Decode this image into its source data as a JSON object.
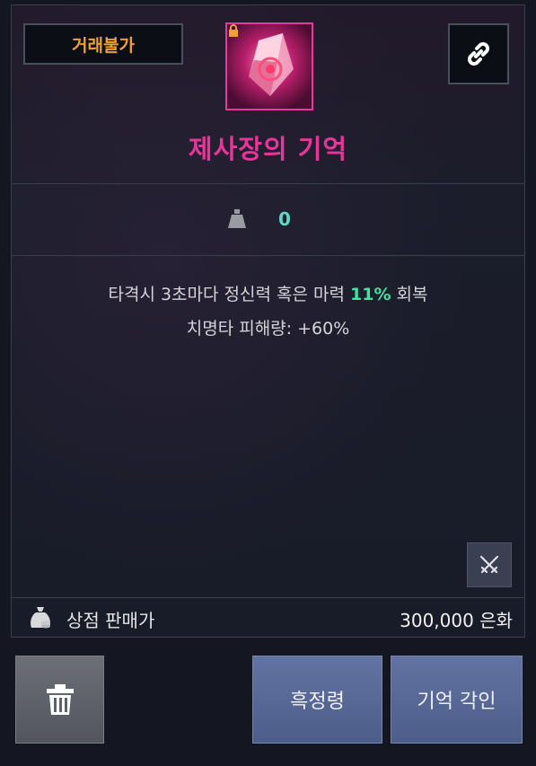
{
  "item": {
    "trade_status": "거래불가",
    "name": "제사장의 기억",
    "weight": "0",
    "icon": "pink-memory-crystal-icon",
    "rarity_color": "#e8359a"
  },
  "effects": {
    "line1_prefix": "타격시 3초마다 정신력 혹은 마력 ",
    "line1_highlight": "11%",
    "line1_suffix": " 회복",
    "line2": "치명타 피해량: +60%"
  },
  "sell": {
    "label": "상점 판매가",
    "value": "300,000 은화"
  },
  "buttons": {
    "black_spirit": "흑정령",
    "memory_engrave": "기억 각인"
  },
  "colors": {
    "trade_status": "#f0a030",
    "weight_value": "#5fd7c9",
    "highlight": "#45e0a0",
    "button_blue": "#5667974"
  }
}
